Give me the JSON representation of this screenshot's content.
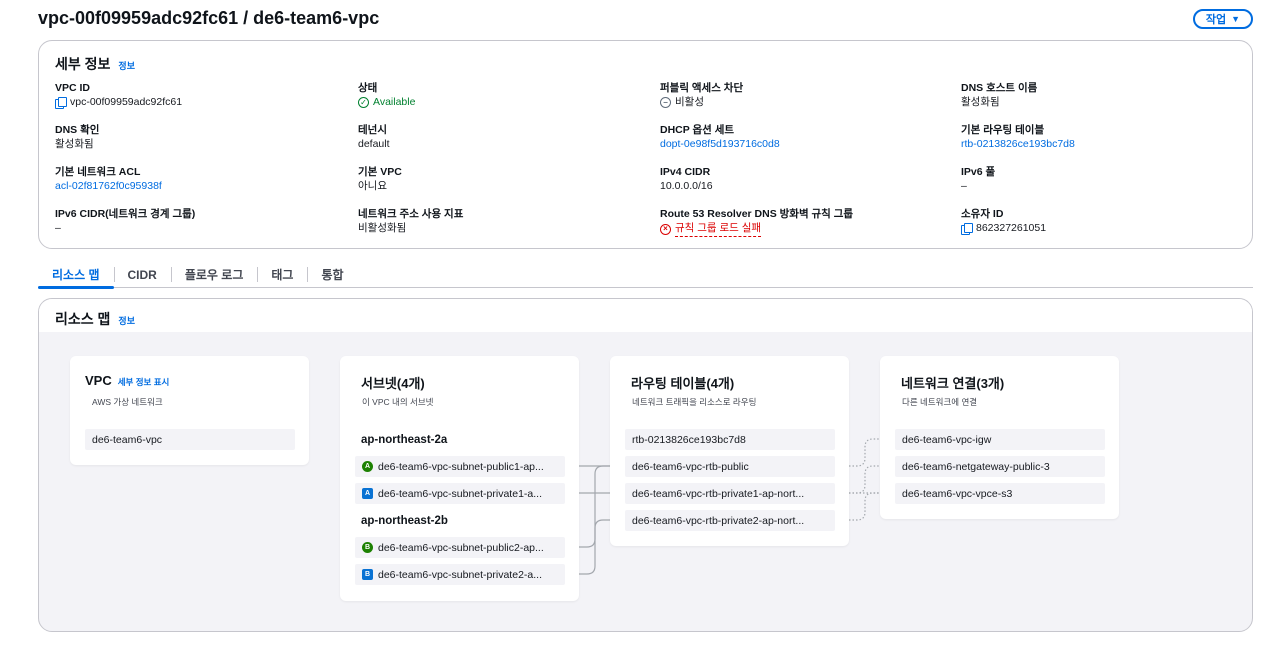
{
  "page": {
    "title": "vpc-00f09959adc92fc61 / de6-team6-vpc",
    "actions_label": "작업"
  },
  "details": {
    "title": "세부 정보",
    "info_label": "정보",
    "fields": {
      "vpc_id": {
        "label": "VPC ID",
        "value": "vpc-00f09959adc92fc61"
      },
      "state": {
        "label": "상태",
        "value": "Available"
      },
      "public_access": {
        "label": "퍼블릭 액세스 차단",
        "value": "비활성"
      },
      "dns_hostnames": {
        "label": "DNS 호스트 이름",
        "value": "활성화됨"
      },
      "dns_resolution": {
        "label": "DNS 확인",
        "value": "활성화됨"
      },
      "tenancy": {
        "label": "테넌시",
        "value": "default"
      },
      "dhcp": {
        "label": "DHCP 옵션 세트",
        "value": "dopt-0e98f5d193716c0d8"
      },
      "main_rtb": {
        "label": "기본 라우팅 테이블",
        "value": "rtb-0213826ce193bc7d8"
      },
      "main_acl": {
        "label": "기본 네트워크 ACL",
        "value": "acl-02f81762f0c95938f"
      },
      "default_vpc": {
        "label": "기본 VPC",
        "value": "아니요"
      },
      "ipv4_cidr": {
        "label": "IPv4 CIDR",
        "value": "10.0.0.0/16"
      },
      "ipv6_pool": {
        "label": "IPv6 풀",
        "value": "–"
      },
      "ipv6_cidr": {
        "label": "IPv6 CIDR(네트워크 경계 그룹)",
        "value": "–"
      },
      "nau": {
        "label": "네트워크 주소 사용 지표",
        "value": "비활성화됨"
      },
      "route53": {
        "label": "Route 53 Resolver DNS 방화벽 규칙 그룹",
        "value": "규칙 그룹 로드 실패"
      },
      "owner": {
        "label": "소유자 ID",
        "value": "862327261051"
      }
    }
  },
  "tabs": [
    "리소스 맵",
    "CIDR",
    "플로우 로그",
    "태그",
    "통합"
  ],
  "resource_map": {
    "title": "리소스 맵",
    "info_label": "정보",
    "vpc": {
      "title": "VPC",
      "link": "세부 정보 표시",
      "subtitle": "AWS 가상 네트워크",
      "item": "de6-team6-vpc"
    },
    "subnets": {
      "title": "서브넷(4개)",
      "subtitle": "이 VPC 내의 서브넷",
      "groups": [
        {
          "az": "ap-northeast-2a",
          "items": [
            {
              "badge": "A",
              "type": "public",
              "name": "de6-team6-vpc-subnet-public1-ap..."
            },
            {
              "badge": "A",
              "type": "private",
              "name": "de6-team6-vpc-subnet-private1-a..."
            }
          ]
        },
        {
          "az": "ap-northeast-2b",
          "items": [
            {
              "badge": "B",
              "type": "public",
              "name": "de6-team6-vpc-subnet-public2-ap..."
            },
            {
              "badge": "B",
              "type": "private",
              "name": "de6-team6-vpc-subnet-private2-a..."
            }
          ]
        }
      ]
    },
    "route_tables": {
      "title": "라우팅 테이블(4개)",
      "subtitle": "네트워크 트래픽을 리소스로 라우팅",
      "items": [
        "rtb-0213826ce193bc7d8",
        "de6-team6-vpc-rtb-public",
        "de6-team6-vpc-rtb-private1-ap-nort...",
        "de6-team6-vpc-rtb-private2-ap-nort..."
      ]
    },
    "connections": {
      "title": "네트워크 연결(3개)",
      "subtitle": "다른 네트워크에 연결",
      "items": [
        "de6-team6-vpc-igw",
        "de6-team6-netgateway-public-3",
        "de6-team6-vpc-vpce-s3"
      ]
    }
  },
  "colors": {
    "accent": "#006ce0",
    "success": "#00802f",
    "error": "#db0000",
    "public_badge": "#1d8102",
    "private_badge": "#0972d3"
  }
}
